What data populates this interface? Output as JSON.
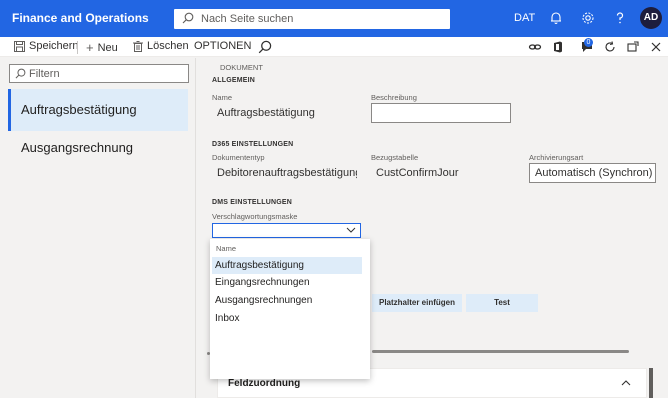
{
  "topbar": {
    "app_title": "Finance and Operations",
    "search_placeholder": "Nach Seite suchen",
    "company": "DAT",
    "avatar_initials": "AD",
    "icons": [
      "bell-icon",
      "gear-icon",
      "help-icon"
    ]
  },
  "actionbar": {
    "save": "Speichern",
    "new": "Neu",
    "delete": "Löschen",
    "options": "OPTIONEN",
    "right_icons": [
      "link-icon",
      "office-icon",
      "attachment-icon",
      "refresh-icon",
      "open-new-icon",
      "close-icon"
    ],
    "attachment_badge": "0"
  },
  "leftpane": {
    "filter_placeholder": "Filtern",
    "items": [
      {
        "label": "Auftragsbestätigung",
        "selected": true
      },
      {
        "label": "Ausgangsrechnung",
        "selected": false
      }
    ]
  },
  "document": {
    "header": "DOKUMENT",
    "general": {
      "title": "ALLGEMEIN",
      "name_label": "Name",
      "name_value": "Auftragsbestätigung",
      "description_label": "Beschreibung",
      "description_value": ""
    },
    "d365": {
      "title": "D365 EINSTELLUNGEN",
      "doctype_label": "Dokumententyp",
      "doctype_value": "Debitorenauftragsbestätigung",
      "reftable_label": "Bezugstabelle",
      "reftable_value": "CustConfirmJour",
      "archive_label": "Archivierungsart",
      "archive_value": "Automatisch (Synchron)"
    },
    "dms": {
      "title": "DMS EINSTELLUNGEN",
      "keyword_mask_label": "Verschlagwortungsmaske",
      "keyword_mask_value": ""
    },
    "buttons": {
      "insert_placeholder": "Platzhalter einfügen",
      "test": "Test"
    },
    "field_mapping": {
      "title": "Feldzuordnung"
    }
  },
  "dropdown": {
    "header": "Name",
    "options": [
      {
        "label": "Auftragsbestätigung",
        "highlighted": true
      },
      {
        "label": "Eingangsrechnungen",
        "highlighted": false
      },
      {
        "label": "Ausgangsrechnungen",
        "highlighted": false
      },
      {
        "label": "Inbox",
        "highlighted": false
      }
    ]
  },
  "colors": {
    "accent": "#2266e3",
    "selected_bg": "#deecf9"
  }
}
